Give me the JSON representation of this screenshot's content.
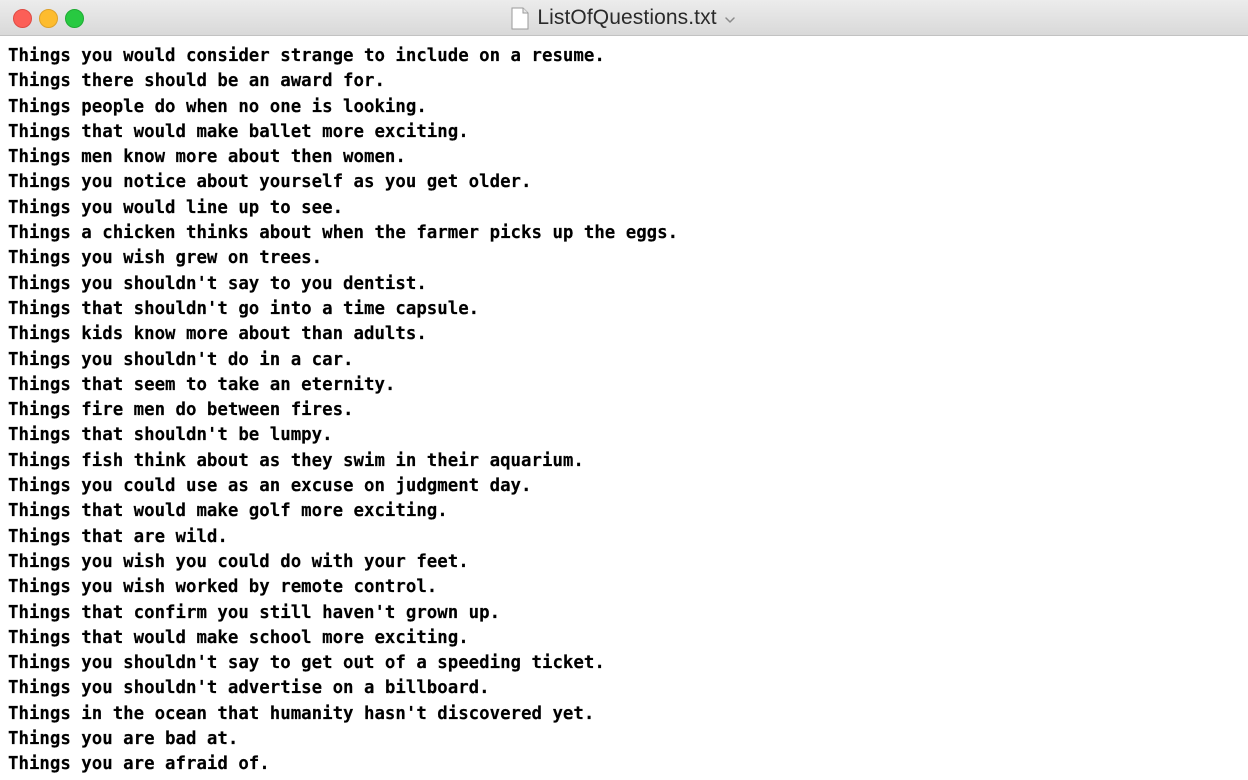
{
  "window": {
    "title": "ListOfQuestions.txt"
  },
  "icons": {
    "close": "close-icon",
    "minimize": "minimize-icon",
    "zoom": "zoom-icon",
    "document": "document-icon",
    "title_menu": "chevron-down-icon"
  },
  "colors": {
    "close": "#fc5f57",
    "minimize": "#fdbc2e",
    "zoom": "#28c941"
  },
  "lines": [
    "Things you would consider strange to include on a resume.",
    "Things there should be an award for.",
    "Things people do when no one is looking.",
    "Things that would make ballet more exciting.",
    "Things men know more about then women.",
    "Things you notice about yourself as you get older.",
    "Things you would line up to see.",
    "Things a chicken thinks about when the farmer picks up the eggs.",
    "Things you wish grew on trees.",
    "Things you shouldn't say to you dentist.",
    "Things that shouldn't go into a time capsule.",
    "Things kids know more about than adults.",
    "Things you shouldn't do in a car.",
    "Things that seem to take an eternity.",
    "Things fire men do between fires.",
    "Things that shouldn't be lumpy.",
    "Things fish think about as they swim in their aquarium.",
    "Things you could use as an excuse on judgment day.",
    "Things that would make golf more exciting.",
    "Things that are wild.",
    "Things you wish you could do with your feet.",
    "Things you wish worked by remote control.",
    "Things that confirm you still haven't grown up.",
    "Things that would make school more exciting.",
    "Things you shouldn't say to get out of a speeding ticket.",
    "Things you shouldn't advertise on a billboard.",
    "Things in the ocean that humanity hasn't discovered yet.",
    "Things you are bad at.",
    "Things you are afraid of."
  ]
}
